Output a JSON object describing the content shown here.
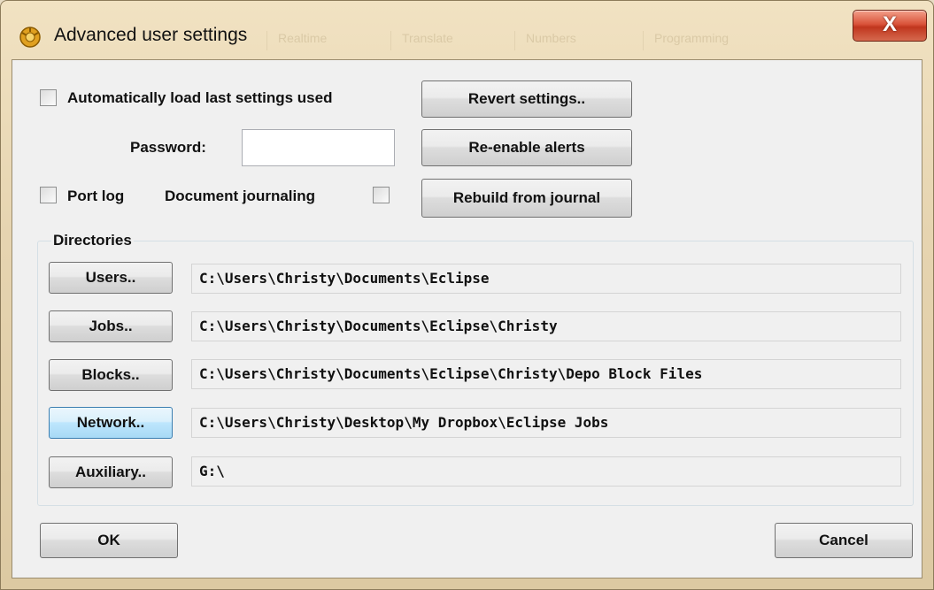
{
  "window": {
    "title": "Advanced user settings",
    "close_label": "X",
    "background_tabs": [
      "Realtime",
      "Translate",
      "Numbers",
      "Programming"
    ]
  },
  "options": {
    "auto_load_label": "Automatically load last settings used",
    "auto_load_checked": false,
    "password_label": "Password:",
    "password_value": "",
    "port_log_label": "Port log",
    "port_log_checked": false,
    "doc_journaling_label": "Document journaling",
    "doc_journaling_checked": false
  },
  "actions": {
    "revert": "Revert settings..",
    "reenable": "Re-enable alerts",
    "rebuild": "Rebuild from journal"
  },
  "directories": {
    "title": "Directories",
    "items": [
      {
        "button": "Users..",
        "path": "C:\\Users\\Christy\\Documents\\Eclipse"
      },
      {
        "button": "Jobs..",
        "path": "C:\\Users\\Christy\\Documents\\Eclipse\\Christy"
      },
      {
        "button": "Blocks..",
        "path": "C:\\Users\\Christy\\Documents\\Eclipse\\Christy\\Depo Block Files"
      },
      {
        "button": "Network..",
        "path": "C:\\Users\\Christy\\Desktop\\My Dropbox\\Eclipse Jobs"
      },
      {
        "button": "Auxiliary..",
        "path": "G:\\"
      }
    ]
  },
  "footer": {
    "ok": "OK",
    "cancel": "Cancel"
  },
  "colors": {
    "close_button": "#c84a30",
    "focus_button": "#bee6fd",
    "client_bg": "#f0f0f0"
  }
}
